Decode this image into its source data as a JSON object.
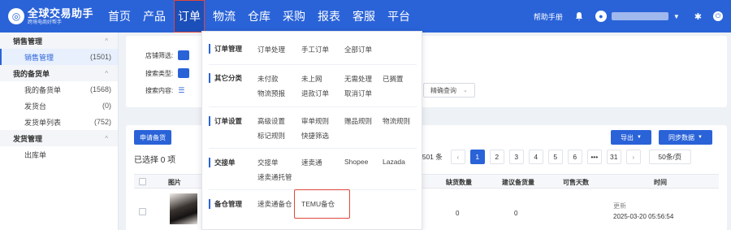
{
  "brand": {
    "name": "全球交易助手",
    "tagline": "跨境电商好帮手"
  },
  "nav": {
    "items": [
      "首页",
      "产品",
      "订单",
      "物流",
      "仓库",
      "采购",
      "报表",
      "客服",
      "平台"
    ]
  },
  "top_right": {
    "help": "帮助手册"
  },
  "sidebar": {
    "groups": [
      {
        "title": "销售管理",
        "items": [
          {
            "label": "销售管理",
            "count": "(1501)",
            "active": true
          }
        ]
      },
      {
        "title": "我的备货单",
        "items": [
          {
            "label": "我的备货单",
            "count": "(1568)"
          },
          {
            "label": "发货台",
            "count": "(0)"
          },
          {
            "label": "发货单列表",
            "count": "(752)"
          }
        ]
      },
      {
        "title": "发货管理",
        "items": [
          {
            "label": "出库单",
            "count": ""
          }
        ]
      }
    ]
  },
  "filters": {
    "store_label": "店铺筛选:",
    "search_type_label": "搜索类型:",
    "search_content_label": "搜索内容:",
    "precise_query": "精确查询"
  },
  "list": {
    "apply_stock_button": "申请备货",
    "export_button": "导出",
    "sync_button": "同步数据",
    "selected_count": "已选择 0 项",
    "pager": {
      "total": "1501 条",
      "pages": [
        "1",
        "2",
        "3",
        "4",
        "5",
        "6",
        "•••",
        "31"
      ],
      "current": "1",
      "page_size": "50条/页"
    },
    "columns": {
      "image": "图片",
      "shortage": "缺货数量",
      "suggested": "建议备货量",
      "sellable_days": "可售天数",
      "time": "时间"
    },
    "rows": [
      {
        "shortage": "0",
        "suggested": "0",
        "time_label": "更新",
        "time_value": "2025-03-20 05:56:54"
      }
    ]
  },
  "order_menu": {
    "sections": [
      {
        "title": "订单管理",
        "links": [
          "订单处理",
          "手工订单",
          "全部订单"
        ]
      },
      {
        "title": "其它分类",
        "links": [
          "未付款",
          "未上网",
          "无需处理",
          "已搁置",
          "物流预报",
          "退款订单",
          "取消订单"
        ]
      },
      {
        "title": "订单设置",
        "links": [
          "高级设置",
          "审单规则",
          "赠品规则",
          "物流规则",
          "标记规则",
          "快捷筛选"
        ]
      },
      {
        "title": "交接单",
        "links": [
          "交接单",
          "速卖通",
          "Shopee",
          "Lazada",
          "速卖通托管"
        ]
      },
      {
        "title": "备仓管理",
        "links": [
          "速卖通备仓",
          "TEMU备仓"
        ]
      }
    ]
  },
  "colors": {
    "primary": "#2a63d8",
    "highlight": "#e0463b"
  }
}
